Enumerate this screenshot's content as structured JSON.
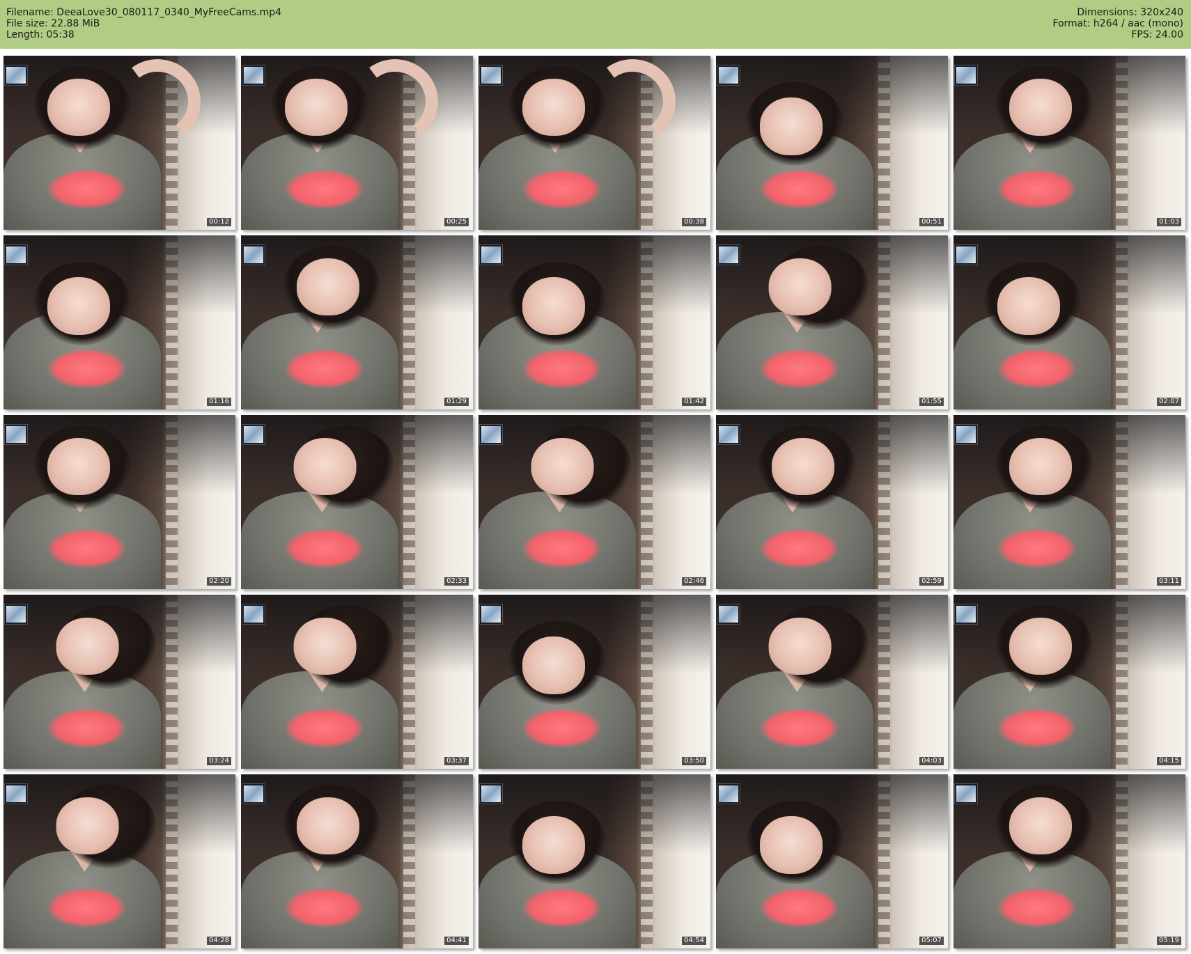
{
  "header": {
    "filename": "Filename: DeeaLove30_080117_0340_MyFreeCams.mp4",
    "file_size": "File size: 22.88 MiB",
    "length": "Length: 05:38",
    "dimensions": "Dimensions: 320x240",
    "format": "Format: h264 / aac (mono)",
    "fps": "FPS: 24.00"
  },
  "colors": {
    "header_bg": "#b1cc84",
    "timestamp_bg": "#141414",
    "timestamp_text": "#ffffff"
  },
  "thumbnails": [
    {
      "time": "00:12",
      "arm_raised": true
    },
    {
      "time": "00:25",
      "arm_raised": true
    },
    {
      "time": "00:38",
      "arm_raised": true
    },
    {
      "time": "00:51",
      "arm_raised": false
    },
    {
      "time": "01:03",
      "arm_raised": false
    },
    {
      "time": "01:16",
      "arm_raised": false
    },
    {
      "time": "01:29",
      "arm_raised": false
    },
    {
      "time": "01:42",
      "arm_raised": false
    },
    {
      "time": "01:55",
      "arm_raised": false
    },
    {
      "time": "02:07",
      "arm_raised": false
    },
    {
      "time": "02:20",
      "arm_raised": false
    },
    {
      "time": "02:33",
      "arm_raised": false
    },
    {
      "time": "02:46",
      "arm_raised": false
    },
    {
      "time": "02:59",
      "arm_raised": false
    },
    {
      "time": "03:11",
      "arm_raised": false
    },
    {
      "time": "03:24",
      "arm_raised": false
    },
    {
      "time": "03:37",
      "arm_raised": false
    },
    {
      "time": "03:50",
      "arm_raised": false
    },
    {
      "time": "04:03",
      "arm_raised": false
    },
    {
      "time": "04:15",
      "arm_raised": false
    },
    {
      "time": "04:28",
      "arm_raised": false
    },
    {
      "time": "04:41",
      "arm_raised": false
    },
    {
      "time": "04:54",
      "arm_raised": false
    },
    {
      "time": "05:07",
      "arm_raised": false
    },
    {
      "time": "05:19",
      "arm_raised": false
    }
  ]
}
